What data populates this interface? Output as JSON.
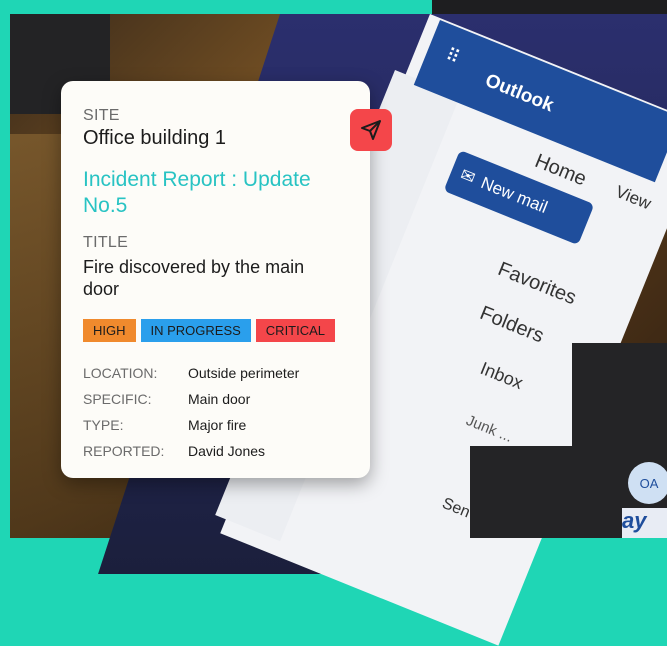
{
  "card": {
    "site_label": "SITE",
    "site_name": "Office building 1",
    "heading": "Incident Report : Update No.5",
    "title_label": "TITLE",
    "title_text": "Fire discovered by the main door",
    "tags": {
      "high": "HIGH",
      "progress": "IN PROGRESS",
      "critical": "CRITICAL"
    },
    "fields": [
      {
        "key": "LOCATION:",
        "value": "Outside perimeter"
      },
      {
        "key": "SPECIFIC:",
        "value": "Main door"
      },
      {
        "key": "TYPE:",
        "value": "Major fire"
      },
      {
        "key": "REPORTED:",
        "value": "David Jones"
      }
    ]
  },
  "outlook": {
    "title": "Outlook",
    "home_tab": "Home",
    "view_tab": "View",
    "new_mail": "New mail",
    "favorites": "Favorites",
    "folders": "Folders",
    "inbox": "Inbox",
    "junk": "Junk ...",
    "sent": "Sen",
    "avatar_initials": "OA",
    "pay_text": "ay"
  },
  "colors": {
    "accent_teal": "#28c3c3",
    "high": "#f08a2d",
    "progress": "#2a9fec",
    "critical": "#f4464a",
    "outlook_blue": "#1f4e9c"
  },
  "icons": [
    "send-icon",
    "mail-icon",
    "calendar-icon",
    "people-icon",
    "grid-icon",
    "trash-icon",
    "chevron-down-icon"
  ]
}
